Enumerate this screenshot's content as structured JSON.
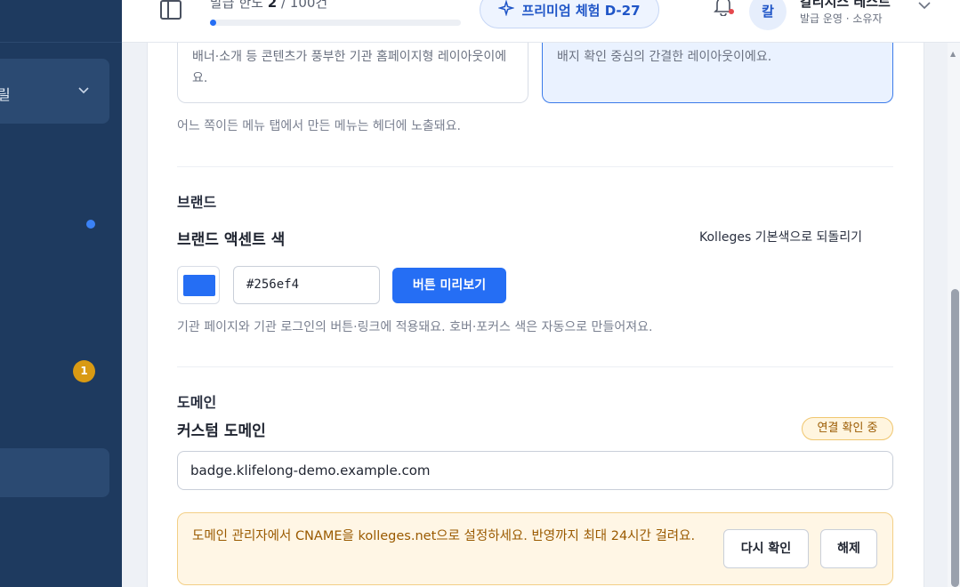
{
  "header": {
    "quota_prefix": "발급 한도",
    "quota_used": "2",
    "quota_total": "/ 100건",
    "quota_progress": 0.02,
    "premium_label": "프리미엄 체험 D-27",
    "avatar_initial": "칼",
    "user_name": "칼리지스 테스트",
    "user_role": "발급 운영 · 소유자"
  },
  "sidebar": {
    "active_item_label": "릴",
    "badge_count": "1"
  },
  "layout": {
    "option_a_desc": "배너·소개 등 콘텐츠가 풍부한 기관 홈페이지형 레이아웃이에요.",
    "option_b_desc": "배지 확인 중심의 간결한 레이아웃이에요.",
    "note": "어느 쪽이든 메뉴 탭에서 만든 메뉴는 헤더에 노출돼요."
  },
  "brand": {
    "section_title": "브랜드",
    "field_title": "브랜드 액센트 색",
    "reset_label": "Kolleges 기본색으로 되돌리기",
    "accent_color": "#256ef4",
    "hex_value": "#256ef4",
    "preview_button": "버튼 미리보기",
    "help": "기관 페이지와 기관 로그인의 버튼·링크에 적용돼요. 호버·포커스 색은 자동으로 만들어져요."
  },
  "domain": {
    "section_title": "도메인",
    "field_title": "커스텀 도메인",
    "status": "연결 확인 중",
    "value": "badge.klifelong-demo.example.com",
    "alert_text": "도메인 관리자에서 CNAME을 kolleges.net으로 설정하세요. 반영까지 최대 24시간 걸려요.",
    "recheck_button": "다시 확인",
    "release_button": "해제"
  }
}
